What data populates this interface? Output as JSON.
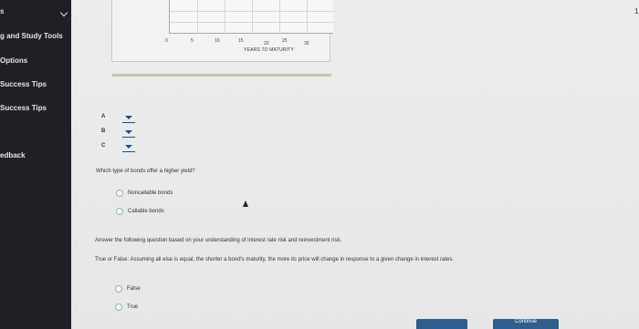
{
  "sidebar": {
    "top_label": "s",
    "items": [
      {
        "label": "g and Study Tools"
      },
      {
        "label": "Options"
      },
      {
        "label": "Success Tips"
      },
      {
        "label": "Success Tips"
      },
      {
        "label": "edback"
      }
    ]
  },
  "chart_data": {
    "type": "line",
    "y_tick_visible": "3",
    "x_ticks": [
      "0",
      "5",
      "10",
      "15",
      "20",
      "25",
      "30"
    ],
    "xlabel": "YEARS TO MATURITY"
  },
  "dropdowns": [
    {
      "label": "A"
    },
    {
      "label": "B"
    },
    {
      "label": "C"
    }
  ],
  "question1": {
    "text": "Which type of bonds offer a higher yield?",
    "options": [
      "Noncallable bonds",
      "Callable bonds"
    ]
  },
  "instruction": "Answer the following question based on your understanding of interest rate risk and reinvestment risk.",
  "question2": {
    "text": "True or False: Assuming all else is equal, the shorter a bond's maturity, the more its price will change in response to a given change in interest rates.",
    "options": [
      "False",
      "True"
    ]
  },
  "buttons": {
    "left_label": "",
    "right_label": "Continue"
  },
  "corner_mark": "1"
}
